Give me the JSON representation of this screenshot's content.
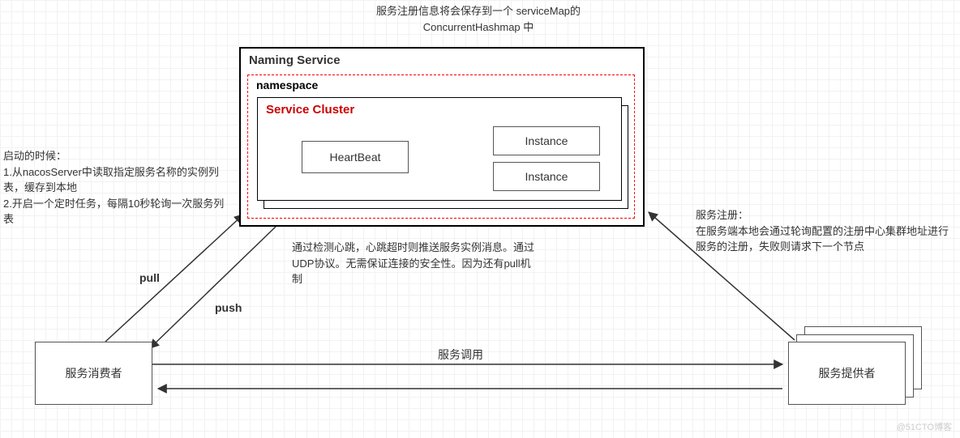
{
  "notes": {
    "top": "服务注册信息将会保存到一个 serviceMap的\nConcurrentHashmap 中",
    "left": "启动的时候：\n1.从nacosServer中读取指定服务名称的实例列表，缓存到本地\n2.开启一个定时任务，每隔10秒轮询一次服务列表",
    "mid": "通过检测心跳，心跳超时则推送服务实例消息。通过UDP协议。无需保证连接的安全性。因为还有pull机制",
    "right": "服务注册：\n在服务端本地会通过轮询配置的注册中心集群地址进行服务的注册，失败则请求下一个节点"
  },
  "labels": {
    "naming": "Naming Service",
    "namespace": "namespace",
    "cluster": "Service Cluster",
    "heartbeat": "HeartBeat",
    "instance1": "Instance",
    "instance2": "Instance",
    "consumer": "服务消费者",
    "provider": "服务提供者",
    "pull": "pull",
    "push": "push",
    "call": "服务调用"
  },
  "watermark": "@51CTO博客"
}
